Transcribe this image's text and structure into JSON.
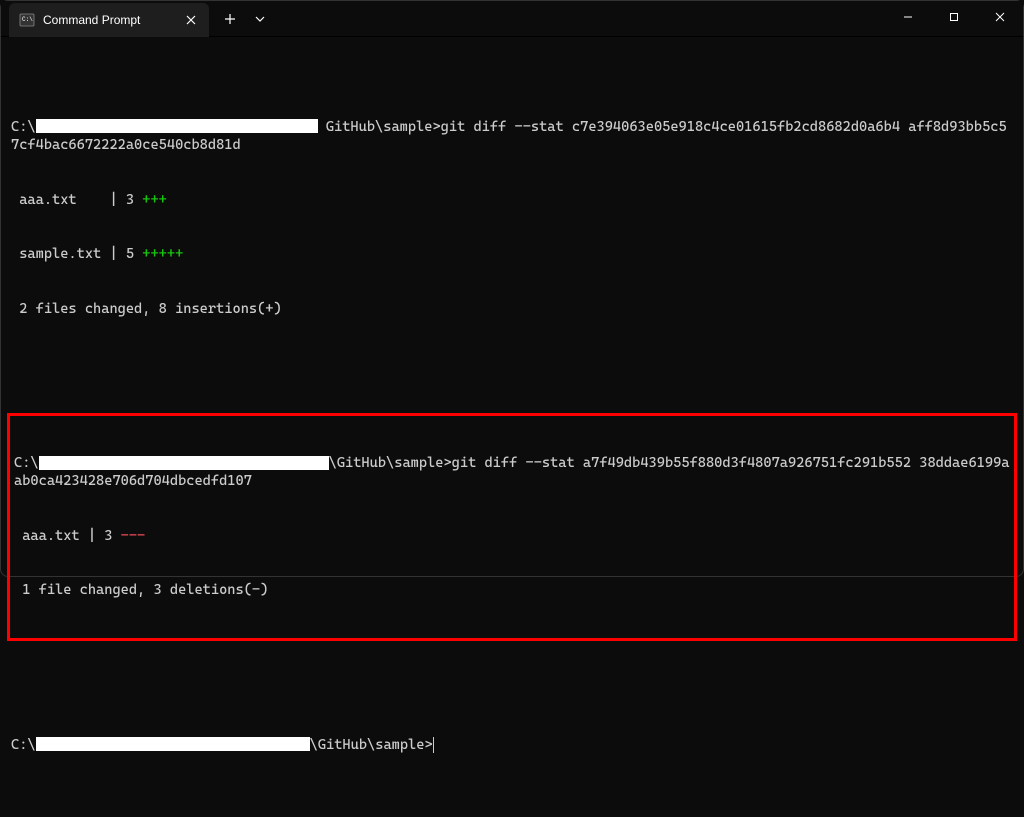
{
  "titlebar": {
    "tab_title": "Command Prompt"
  },
  "block1": {
    "prompt_prefix": "C:\\",
    "prompt_suffix": " GitHub\\sample>",
    "command": "git diff --stat c7e394063e05e918c4ce01615fb2cd8682d0a6b4 aff8d93bb5c57cf4bac6672222a0ce540cb8d81d",
    "stat1_file": " aaa.txt    | 3 ",
    "stat1_marks": "+++",
    "stat2_file": " sample.txt | 5 ",
    "stat2_marks": "+++++",
    "summary": " 2 files changed, 8 insertions(+)"
  },
  "block2": {
    "prompt_prefix": "C:\\",
    "prompt_suffix": "\\GitHub\\sample>",
    "command": "git diff --stat a7f49db439b55f880d3f4807a926751fc291b552 38ddae6199aab0ca423428e706d704dbcedfd107",
    "stat1_file": " aaa.txt | 3 ",
    "stat1_marks": "---",
    "summary": " 1 file changed, 3 deletions(-)"
  },
  "block3": {
    "prompt_prefix": "C:\\",
    "prompt_suffix": "\\GitHub\\sample>"
  },
  "redacted_widths": {
    "w1": 282,
    "w2": 290,
    "w3": 274
  }
}
